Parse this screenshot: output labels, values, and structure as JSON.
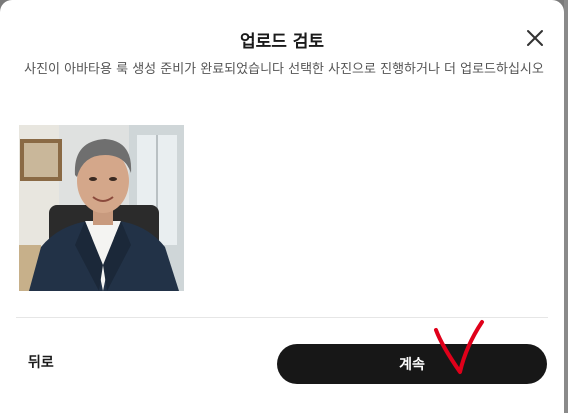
{
  "dialog": {
    "title": "업로드 검토",
    "subtitle": "사진이 아바타용 룩 생성 준비가 완료되었습니다 선택한 사진으로 진행하거나 더 업로드하십시오",
    "close_icon": "close-icon"
  },
  "photo": {
    "icon": "uploaded-photo"
  },
  "footer": {
    "back_label": "뒤로",
    "continue_label": "계속"
  },
  "colors": {
    "primary_button": "#171717",
    "annotation": "#e0001a"
  }
}
